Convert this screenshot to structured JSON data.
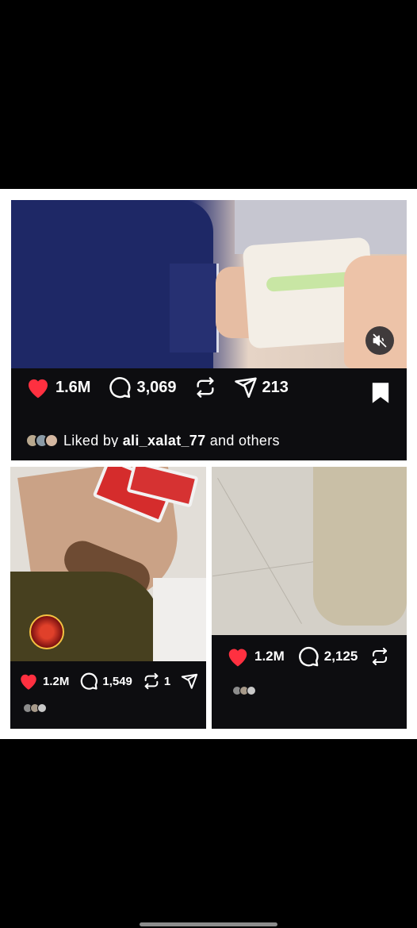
{
  "post_main": {
    "likes": "1.6M",
    "comments": "3,069",
    "shares": "213",
    "liked_by_prefix": "Liked by ",
    "liked_by_user": "ali_xalat_77",
    "liked_by_suffix": " and others"
  },
  "post_left": {
    "likes": "1.2M",
    "comments": "1,549",
    "reposts": "1"
  },
  "post_right": {
    "likes": "1.2M",
    "comments": "2,125"
  },
  "colors": {
    "like_red": "#ff3040",
    "panel_bg": "#0d0d10",
    "screen_bg": "#000000"
  },
  "icons": [
    "heart-icon",
    "comment-icon",
    "repost-icon",
    "send-icon",
    "bookmark-icon",
    "mute-icon"
  ]
}
